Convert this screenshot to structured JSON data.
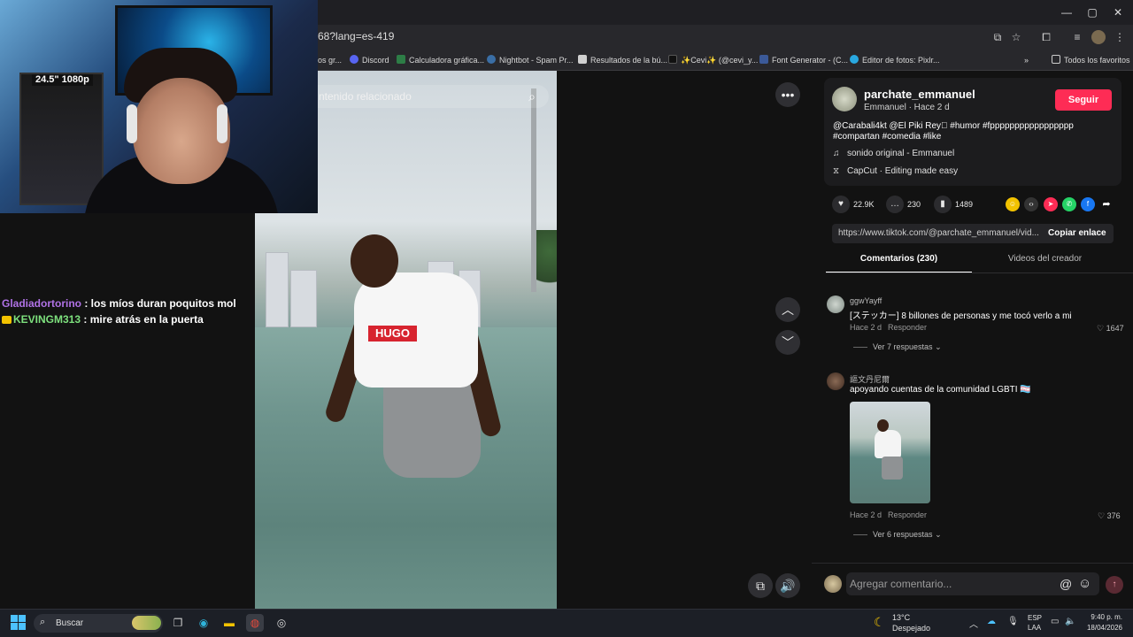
{
  "browser": {
    "url": "68?lang=es-419",
    "bookmarks": [
      {
        "label": "os gr...",
        "icon": "bookmark-icon",
        "color": "#444444"
      },
      {
        "label": "Discord",
        "icon": "discord-icon",
        "color": "#5865f2"
      },
      {
        "label": "Calculadora gráfica...",
        "icon": "desmos-icon",
        "color": "#2d7d46"
      },
      {
        "label": "Nightbot - Spam Pr...",
        "icon": "nightbot-icon",
        "color": "#3a6ea5"
      },
      {
        "label": "Resultados de la bú...",
        "icon": "doc-icon",
        "color": "#d0d0d0"
      },
      {
        "label": "✨Cevi✨ (@cevi_y...",
        "icon": "tiktok-icon",
        "color": "#111111"
      },
      {
        "label": "Font Generator - (C...",
        "icon": "font-icon",
        "color": "#3b5998"
      },
      {
        "label": "Editor de fotos: Pixlr...",
        "icon": "pixlr-icon",
        "color": "#29a8e0"
      }
    ],
    "all_bookmarks": "Todos los favoritos",
    "window_controls": {
      "minimize": "—",
      "maximize": "▢",
      "close": "✕"
    }
  },
  "webcam": {
    "monitor_label": "24.5\" 1080p"
  },
  "chat": [
    {
      "user": "Gladiadortorino",
      "message": ": los míos duran poquitos mol",
      "color": "#b072e6"
    },
    {
      "user": "KEVINGM313",
      "message": ": mire atrás en la puerta",
      "color": "#7de07d"
    }
  ],
  "video": {
    "search_placeholder": "ntenido relacionado",
    "shirt_text": "HUGO"
  },
  "post": {
    "username": "parchate_emmanuel",
    "display": "Emmanuel · Hace 2 d",
    "follow": "Seguir",
    "description": "@Carabali4kt @El Piki Rey🏻 #humor #fppppppppppppppppp #compartan #comedia #like",
    "sound": "sonido original - Emmanuel",
    "capcut": "CapCut · Editing made easy",
    "likes": "22.9K",
    "comments": "230",
    "saves": "1489",
    "link": "https://www.tiktok.com/@parchate_emmanuel/vid...",
    "copy_link": "Copiar enlace",
    "accent": "#fe2c55"
  },
  "tabs": {
    "comments": "Comentarios (230)",
    "videos": "Videos del creador"
  },
  "comments": [
    {
      "user": "ggwYayff",
      "text": "[ステッカー] 8 billones de personas y me tocó verlo a mi",
      "time": "Hace 2 d",
      "reply": "Responder",
      "likes": "1647",
      "more": "Ver 7 respuestas"
    },
    {
      "user": "謳文丹尼爾",
      "text": "apoyando cuentas de la comunidad LGBTI 🏳️‍⚧️",
      "time": "Hace 2 d",
      "reply": "Responder",
      "likes": "376",
      "more": "Ver 6 respuestas"
    }
  ],
  "comment_input": {
    "placeholder": "Agregar comentario..."
  },
  "taskbar": {
    "search": "Buscar",
    "weather_temp": "13°C",
    "weather_desc": "Despejado",
    "lang1": "ESP",
    "lang2": "LAA",
    "time": "9:40 p. m.",
    "date": "18/04/2026"
  }
}
